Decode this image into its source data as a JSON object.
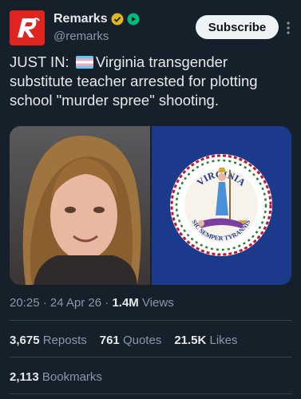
{
  "account": {
    "name": "Remarks",
    "handle": "@remarks",
    "brand_color": "#e0241f",
    "verified_badge": "gold-check-badge-icon",
    "affiliate_badge": "green-play-badge-icon"
  },
  "subscribe_label": "Subscribe",
  "tweet": {
    "prefix": "JUST IN: ",
    "flag_icon": "transgender-flag-icon",
    "text": "Virginia transgender substitute teacher arrested for plotting school \"murder spree\" shooting.",
    "media": [
      "mugshot-photo",
      "virginia-state-seal"
    ]
  },
  "meta": {
    "time": "20:25",
    "sep": " · ",
    "date": "24 Apr 26",
    "views_count": "1.4M",
    "views_label": " Views"
  },
  "stats": {
    "reposts_count": "3,675",
    "reposts_label": " Reposts",
    "quotes_count": "761",
    "quotes_label": " Quotes",
    "likes_count": "21.5K",
    "likes_label": " Likes",
    "bookmarks_count": "2,113",
    "bookmarks_label": " Bookmarks"
  },
  "seal_text": {
    "top": "VIRGINIA",
    "bottom": "SIC SEMPER TYRANNIS"
  }
}
